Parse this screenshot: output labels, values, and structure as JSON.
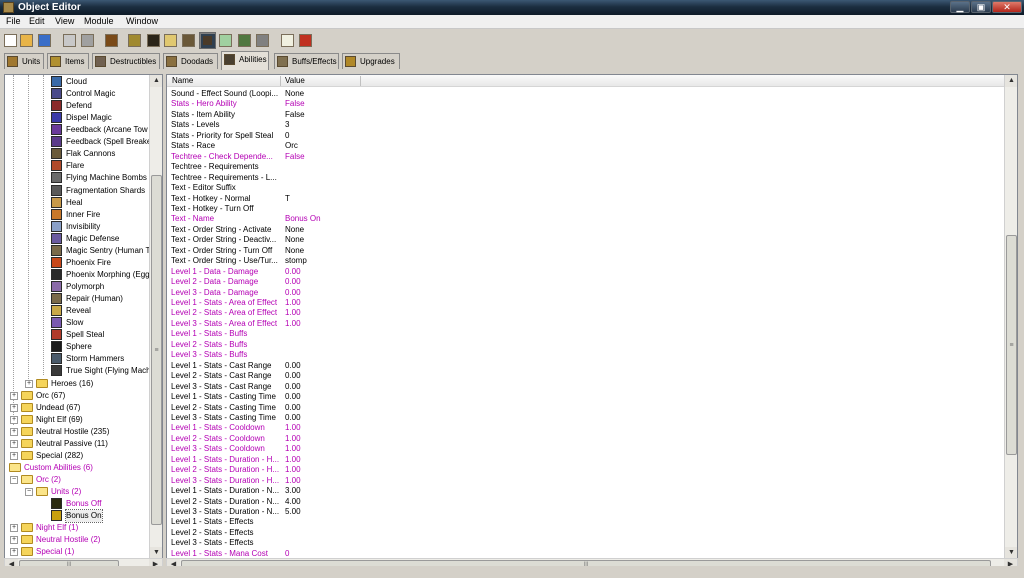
{
  "window": {
    "title": "Object Editor",
    "min_glyph": "▁",
    "max_glyph": "▣",
    "close_glyph": "✕"
  },
  "menu": [
    "File",
    "Edit",
    "View",
    "Module",
    "Window"
  ],
  "toolbar": {
    "icons": [
      "new-file-icon",
      "open-folder-icon",
      "save-icon",
      "copy-icon",
      "paste-icon",
      "unit-editor-icon",
      "terrain-editor-icon",
      "ability-editor-icon",
      "sound-editor-icon",
      "item-editor-icon",
      "object-editor-icon",
      "import-manager-icon",
      "trigger-editor-icon",
      "script-icon",
      "ai-editor-icon",
      "test-map-icon"
    ],
    "colors": [
      "#ffffff",
      "#e8b448",
      "#3a6ec8",
      "#c8c8c8",
      "#a0a0a0",
      "#7a4a18",
      "#a08a30",
      "#2a2418",
      "#e0c870",
      "#6a5838",
      "#304050",
      "#a0d0a0",
      "#507840",
      "#808080",
      "#f0f0e0",
      "#c03020"
    ]
  },
  "tabs": [
    {
      "label": "Units",
      "color": "#a07830"
    },
    {
      "label": "Items",
      "color": "#b09030"
    },
    {
      "label": "Destructibles",
      "color": "#706050"
    },
    {
      "label": "Doodads",
      "color": "#8a7040"
    },
    {
      "label": "Abilities",
      "color": "#4a4030"
    },
    {
      "label": "Buffs/Effects",
      "color": "#807050"
    },
    {
      "label": "Upgrades",
      "color": "#b08828"
    }
  ],
  "tree": {
    "abilities": [
      {
        "label": "Cloud",
        "color": "#3a6aa8"
      },
      {
        "label": "Control Magic",
        "color": "#4a4a8a"
      },
      {
        "label": "Defend",
        "color": "#8a2a2a"
      },
      {
        "label": "Dispel Magic",
        "color": "#3a3aa8"
      },
      {
        "label": "Feedback (Arcane Tow",
        "color": "#6a3a9a"
      },
      {
        "label": "Feedback (Spell Breake",
        "color": "#5a3a8a"
      },
      {
        "label": "Flak Cannons",
        "color": "#6a5a3a"
      },
      {
        "label": "Flare",
        "color": "#b04a2a"
      },
      {
        "label": "Flying Machine Bombs",
        "color": "#6a6a6a"
      },
      {
        "label": "Fragmentation Shards",
        "color": "#5a5a5a"
      },
      {
        "label": "Heal",
        "color": "#c89a4a"
      },
      {
        "label": "Inner Fire",
        "color": "#c8782a"
      },
      {
        "label": "Invisibility",
        "color": "#8aa0c8"
      },
      {
        "label": "Magic Defense",
        "color": "#6a5aa0"
      },
      {
        "label": "Magic Sentry (Human T",
        "color": "#7a6a4a"
      },
      {
        "label": "Phoenix Fire",
        "color": "#c8481a"
      },
      {
        "label": "Phoenix Morphing (Egg",
        "color": "#2a2a2a"
      },
      {
        "label": "Polymorph",
        "color": "#8a6aa8"
      },
      {
        "label": "Repair (Human)",
        "color": "#7a6a4a"
      },
      {
        "label": "Reveal",
        "color": "#c8a848"
      },
      {
        "label": "Slow",
        "color": "#7a5ab0"
      },
      {
        "label": "Spell Steal",
        "color": "#b03a2a"
      },
      {
        "label": "Sphere",
        "color": "#1a1a1a"
      },
      {
        "label": "Storm Hammers",
        "color": "#4a5a6a"
      },
      {
        "label": "True Sight (Flying Mach",
        "color": "#3a3a3a"
      }
    ],
    "nodes": [
      {
        "label": "Heroes (16)"
      },
      {
        "label": "Orc (67)"
      },
      {
        "label": "Undead (67)"
      },
      {
        "label": "Night Elf (69)"
      },
      {
        "label": "Neutral Hostile (235)"
      },
      {
        "label": "Neutral Passive (11)"
      },
      {
        "label": "Special (282)"
      }
    ],
    "custom": [
      {
        "label": "Custom Abilities (6)"
      },
      {
        "label": "Orc (2)"
      },
      {
        "label": "Units (2)"
      },
      {
        "label": "Bonus Off"
      },
      {
        "label": "Bonus On"
      },
      {
        "label": "Night Elf (1)"
      },
      {
        "label": "Neutral Hostile (2)"
      },
      {
        "label": "Special (1)"
      }
    ],
    "expanders": {
      "plus": "+",
      "minus": "−"
    }
  },
  "grid": {
    "headers": {
      "name": "Name",
      "value": "Value"
    },
    "rows": [
      {
        "name": "Sound - Effect Sound (Loopi...",
        "value": "None",
        "modified": false
      },
      {
        "name": "Stats - Hero Ability",
        "value": "False",
        "modified": true
      },
      {
        "name": "Stats - Item Ability",
        "value": "False",
        "modified": false
      },
      {
        "name": "Stats - Levels",
        "value": "3",
        "modified": false
      },
      {
        "name": "Stats - Priority for Spell Steal",
        "value": "0",
        "modified": false
      },
      {
        "name": "Stats - Race",
        "value": "Orc",
        "modified": false
      },
      {
        "name": "Techtree - Check Depende...",
        "value": "False",
        "modified": true
      },
      {
        "name": "Techtree - Requirements",
        "value": "",
        "modified": false
      },
      {
        "name": "Techtree - Requirements - L...",
        "value": "",
        "modified": false
      },
      {
        "name": "Text - Editor Suffix",
        "value": "",
        "modified": false
      },
      {
        "name": "Text - Hotkey - Normal",
        "value": "T",
        "modified": false
      },
      {
        "name": "Text - Hotkey - Turn Off",
        "value": "",
        "modified": false
      },
      {
        "name": "Text - Name",
        "value": "Bonus On",
        "modified": true
      },
      {
        "name": "Text - Order String - Activate",
        "value": "None",
        "modified": false
      },
      {
        "name": "Text - Order String - Deactiv...",
        "value": "None",
        "modified": false
      },
      {
        "name": "Text - Order String - Turn Off",
        "value": "None",
        "modified": false
      },
      {
        "name": "Text - Order String - Use/Tur...",
        "value": "stomp",
        "modified": false
      },
      {
        "name": "Level 1 - Data - Damage",
        "value": "0.00",
        "modified": true
      },
      {
        "name": "Level 2 - Data - Damage",
        "value": "0.00",
        "modified": true
      },
      {
        "name": "Level 3 - Data - Damage",
        "value": "0.00",
        "modified": true
      },
      {
        "name": "Level 1 - Stats - Area of Effect",
        "value": "1.00",
        "modified": true
      },
      {
        "name": "Level 2 - Stats - Area of Effect",
        "value": "1.00",
        "modified": true
      },
      {
        "name": "Level 3 - Stats - Area of Effect",
        "value": "1.00",
        "modified": true
      },
      {
        "name": "Level 1 - Stats - Buffs",
        "value": "",
        "modified": true
      },
      {
        "name": "Level 2 - Stats - Buffs",
        "value": "",
        "modified": true
      },
      {
        "name": "Level 3 - Stats - Buffs",
        "value": "",
        "modified": true
      },
      {
        "name": "Level 1 - Stats - Cast Range",
        "value": "0.00",
        "modified": false
      },
      {
        "name": "Level 2 - Stats - Cast Range",
        "value": "0.00",
        "modified": false
      },
      {
        "name": "Level 3 - Stats - Cast Range",
        "value": "0.00",
        "modified": false
      },
      {
        "name": "Level 1 - Stats - Casting Time",
        "value": "0.00",
        "modified": false
      },
      {
        "name": "Level 2 - Stats - Casting Time",
        "value": "0.00",
        "modified": false
      },
      {
        "name": "Level 3 - Stats - Casting Time",
        "value": "0.00",
        "modified": false
      },
      {
        "name": "Level 1 - Stats - Cooldown",
        "value": "1.00",
        "modified": true
      },
      {
        "name": "Level 2 - Stats - Cooldown",
        "value": "1.00",
        "modified": true
      },
      {
        "name": "Level 3 - Stats - Cooldown",
        "value": "1.00",
        "modified": true
      },
      {
        "name": "Level 1 - Stats - Duration - H...",
        "value": "1.00",
        "modified": true
      },
      {
        "name": "Level 2 - Stats - Duration - H...",
        "value": "1.00",
        "modified": true
      },
      {
        "name": "Level 3 - Stats - Duration - H...",
        "value": "1.00",
        "modified": true
      },
      {
        "name": "Level 1 - Stats - Duration - N...",
        "value": "3.00",
        "modified": false
      },
      {
        "name": "Level 2 - Stats - Duration - N...",
        "value": "4.00",
        "modified": false
      },
      {
        "name": "Level 3 - Stats - Duration - N...",
        "value": "5.00",
        "modified": false
      },
      {
        "name": "Level 1 - Stats - Effects",
        "value": "",
        "modified": false
      },
      {
        "name": "Level 2 - Stats - Effects",
        "value": "",
        "modified": false
      },
      {
        "name": "Level 3 - Stats - Effects",
        "value": "",
        "modified": false
      },
      {
        "name": "Level 1 - Stats - Mana Cost",
        "value": "0",
        "modified": true
      }
    ]
  },
  "scroll": {
    "up": "▲",
    "down": "▼",
    "left": "◀",
    "right": "▶",
    "grip": "≡",
    "hgrip": "|||"
  }
}
